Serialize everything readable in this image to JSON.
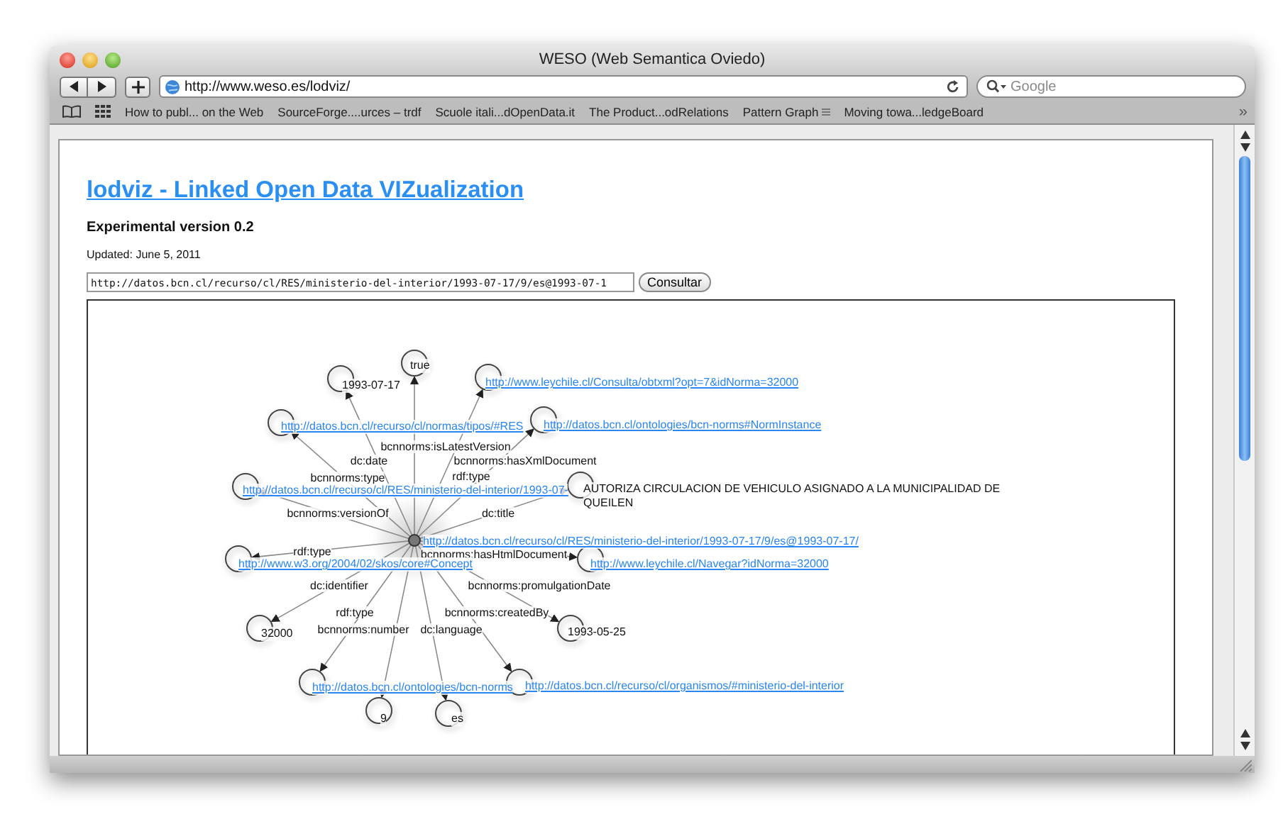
{
  "window": {
    "title": "WESO (Web Semantica Oviedo)"
  },
  "toolbar": {
    "address": "http://www.weso.es/lodviz/",
    "search_placeholder": "Google"
  },
  "bookmarks": [
    {
      "label": "How to publ... on the Web",
      "kind": "link"
    },
    {
      "label": "SourceForge....urces – trdf",
      "kind": "link"
    },
    {
      "label": "Scuole itali...dOpenData.it",
      "kind": "link"
    },
    {
      "label": "The Product...odRelations",
      "kind": "link"
    },
    {
      "label": "Pattern Graph",
      "kind": "folder"
    },
    {
      "label": "Moving towa...ledgeBoard",
      "kind": "link"
    }
  ],
  "bookmarks_overflow": "»",
  "page": {
    "title": "lodviz - Linked Open Data VIZualization",
    "subtitle": "Experimental version 0.2",
    "updated": "Updated: June 5, 2011",
    "query": "http://datos.bcn.cl/recurso/cl/RES/ministerio-del-interior/1993-07-17/9/es@1993-07-1",
    "button": "Consultar"
  },
  "graph": {
    "center": {
      "label": "http://datos.bcn.cl/recurso/cl/RES/ministerio-del-interior/1993-07-17/9/es@1993-07-17/",
      "kind": "link"
    },
    "nodes": [
      {
        "label": "1993-07-17",
        "kind": "literal",
        "edge": "dc:date"
      },
      {
        "label": "true",
        "kind": "literal",
        "edge": "bcnnorms:isLatestVersion"
      },
      {
        "label": "http://www.leychile.cl/Consulta/obtxml?opt=7&idNorma=32000",
        "kind": "link",
        "edge": "bcnnorms:hasXmlDocument"
      },
      {
        "label": "http://datos.bcn.cl/recurso/cl/normas/tipos/#RES",
        "kind": "link",
        "edge": "bcnnorms:type"
      },
      {
        "label": "http://datos.bcn.cl/ontologies/bcn-norms#NormInstance",
        "kind": "link",
        "edge": "rdf:type"
      },
      {
        "label": "http://datos.bcn.cl/recurso/cl/RES/ministerio-del-interior/1993-07-",
        "kind": "link",
        "edge": "bcnnorms:versionOf"
      },
      {
        "label": "AUTORIZA CIRCULACION DE VEHICULO ASIGNADO A LA MUNICIPALIDAD DE QUEILEN",
        "kind": "literal",
        "edge": "dc:title"
      },
      {
        "label": "http://www.w3.org/2004/02/skos/core#Concept",
        "kind": "link",
        "edge": "rdf:type"
      },
      {
        "label": "http://www.leychile.cl/Navegar?idNorma=32000",
        "kind": "link",
        "edge": "bcnnorms:hasHtmlDocument"
      },
      {
        "label": "32000",
        "kind": "literal",
        "edge": "dc:identifier"
      },
      {
        "label": "1993-05-25",
        "kind": "literal",
        "edge": "bcnnorms:promulgationDate"
      },
      {
        "label": "http://datos.bcn.cl/ontologies/bcn-norms",
        "kind": "link",
        "edge": "rdf:type"
      },
      {
        "label": "http://datos.bcn.cl/recurso/cl/organismos/#ministerio-del-interior",
        "kind": "link",
        "edge": "bcnnorms:createdBy"
      },
      {
        "label": "9",
        "kind": "literal",
        "edge": "bcnnorms:number"
      },
      {
        "label": "es",
        "kind": "literal",
        "edge": "dc:language"
      }
    ]
  }
}
